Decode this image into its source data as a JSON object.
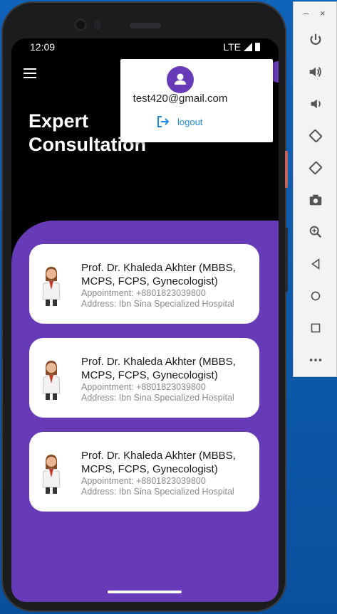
{
  "status_bar": {
    "time": "12:09",
    "network": "LTE"
  },
  "page": {
    "title_line1": "Expert",
    "title_line2": "Consultation"
  },
  "account_popup": {
    "email": "test420@gmail.com",
    "logout_label": "logout"
  },
  "doctors": [
    {
      "name": "Prof. Dr. Khaleda Akhter (MBBS, MCPS, FCPS, Gynecologist)",
      "appointment": "Appointment: +8801823039800",
      "address": "Address: Ibn Sina Specialized Hospital"
    },
    {
      "name": "Prof. Dr. Khaleda Akhter (MBBS, MCPS, FCPS, Gynecologist)",
      "appointment": "Appointment: +8801823039800",
      "address": "Address: Ibn Sina Specialized Hospital"
    },
    {
      "name": "Prof. Dr. Khaleda Akhter (MBBS, MCPS, FCPS, Gynecologist)",
      "appointment": "Appointment: +8801823039800",
      "address": "Address: Ibn Sina Specialized Hospital"
    }
  ],
  "emulator_toolbar": {
    "minimize": "–",
    "close": "×",
    "buttons": [
      "power-icon",
      "volume-up-icon",
      "volume-down-icon",
      "rotate-left-icon",
      "rotate-right-icon",
      "camera-icon",
      "zoom-icon",
      "back-icon",
      "home-icon",
      "overview-icon",
      "more-icon"
    ]
  },
  "colors": {
    "accent": "#673ab7",
    "link": "#1e88e5",
    "background": "#000000"
  }
}
